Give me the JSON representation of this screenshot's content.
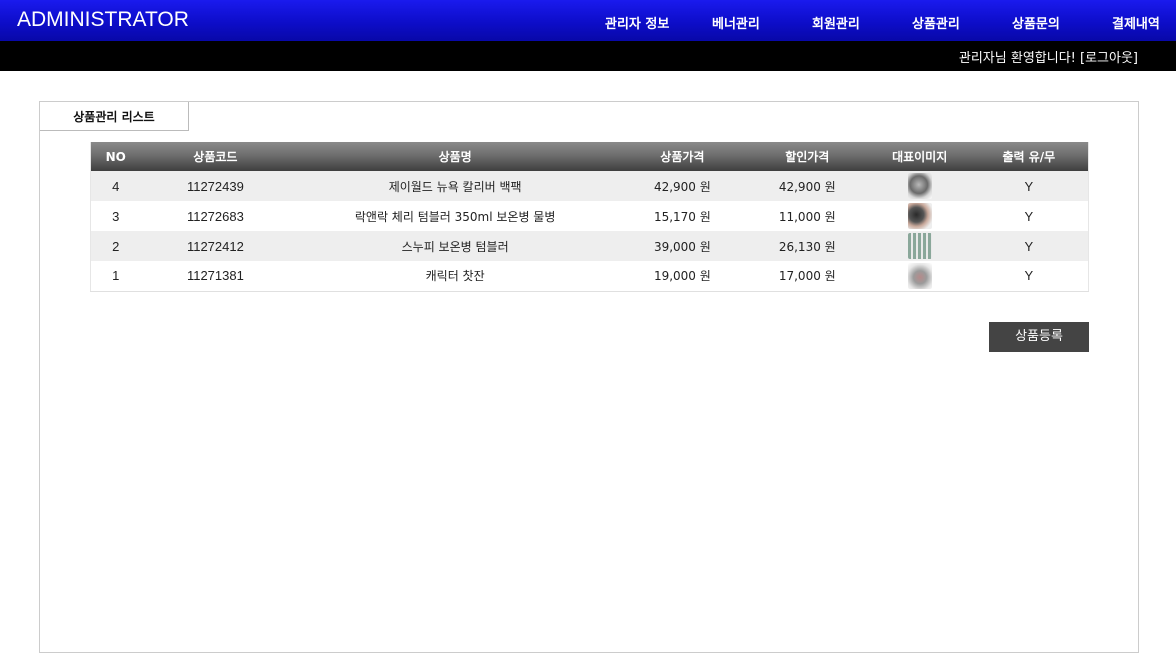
{
  "header": {
    "brand": "ADMINISTRATOR",
    "nav": [
      {
        "label": "관리자 정보"
      },
      {
        "label": "베너관리"
      },
      {
        "label": "회원관리"
      },
      {
        "label": "상품관리"
      },
      {
        "label": "상품문의"
      },
      {
        "label": "결제내역"
      }
    ],
    "welcome": "관리자님 환영합니다!",
    "logout": "[로그아웃]"
  },
  "panel": {
    "tab_label": "상품관리 리스트",
    "columns": [
      "NO",
      "상품코드",
      "상품명",
      "상품가격",
      "할인가격",
      "대표이미지",
      "출력 유/무"
    ],
    "rows": [
      {
        "no": "4",
        "code": "11272439",
        "name": "제이월드 뉴욕 칼리버 백팩",
        "price": "42,900 원",
        "discount": "42,900 원",
        "image_icon": "backpack-thumbnail",
        "display": "Y"
      },
      {
        "no": "3",
        "code": "11272683",
        "name": "락앤락 체리 텀블러 350ml 보온병 물병",
        "price": "15,170 원",
        "discount": "11,000 원",
        "image_icon": "tumbler-thumbnail",
        "display": "Y"
      },
      {
        "no": "2",
        "code": "11272412",
        "name": "스누피 보온병 텀블러",
        "price": "39,000 원",
        "discount": "26,130 원",
        "image_icon": "thermos-thumbnail",
        "display": "Y"
      },
      {
        "no": "1",
        "code": "11271381",
        "name": "캐릭터 찻잔",
        "price": "19,000 원",
        "discount": "17,000 원",
        "image_icon": "teacup-thumbnail",
        "display": "Y"
      }
    ],
    "register_button": "상품등록"
  },
  "colors": {
    "header_blue": "#0d0dc9",
    "subbar_black": "#000000",
    "table_header_dark": "#3e3e3e",
    "row_alt": "#eeeeee",
    "button_dark": "#444444"
  }
}
